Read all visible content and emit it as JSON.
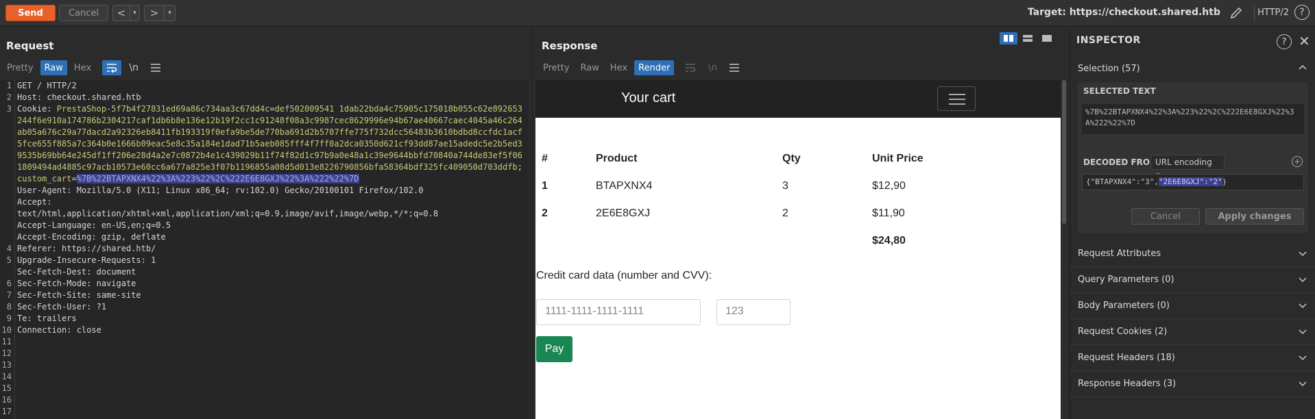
{
  "toolbar": {
    "send_label": "Send",
    "cancel_label": "Cancel",
    "target_label": "Target: https://checkout.shared.htb",
    "protocol": "HTTP/2"
  },
  "request": {
    "title": "Request",
    "tabs": [
      "Pretty",
      "Raw",
      "Hex"
    ],
    "active_tab": "Raw",
    "newline_toggle": "\\n",
    "line_numbers": [
      "1",
      "2",
      "3",
      "",
      "",
      "",
      "",
      "",
      "",
      "",
      "",
      "",
      "4",
      "5",
      "",
      "6",
      "7",
      "8",
      "9",
      "10",
      "11",
      "12",
      "13",
      "14",
      "15",
      "16",
      "17"
    ],
    "lines": {
      "l1": "GET / HTTP/2",
      "l2": "Host: checkout.shared.htb",
      "l3_key": "Cookie: ",
      "l3_ps_name": "PrestaShop-5f7b4f27831ed69a86c734aa3c67dd4c",
      "l3_ps_value": "def502009541 1dab22bda4c75905c175018b055c62e892653244f6e910a174786b2304217caf1db6b8e136e12b19f2cc1c91248f08a3c9987cec8629996e94b67ae40667caec4045a46c264ab05a676c29a77dacd2a92326eb8411fb193319f0efa9be5de770ba691d2b5707ffe775f732dcc56483b3610bdbd8ccfdc1acf5fce655f885a7c364b0e1666b09eac5e8c35a184e1dad71b5aeb085fff4f7ff0a2dca0350d621cf93dd87ae15adedc5e2b5ed39535b69bb64e245df1ff206e28d4a2e7c0872b4e1c439029b11f74f82d1c97b9a0e48a1c39e9644bbfd70840a744de83ef5f061809494ad4885c97acb10573e60cc6a677a825e3f07b1196855a08d5d013e8226790856bfa58364bdf325fc409050d703ddfb",
      "l3_sep": "; ",
      "l3_cart_name": "custom_cart",
      "l3_cart_value": "%7B%22BTAPXNX4%22%3A%223%22%2C%222E6E8GXJ%22%3A%222%22%7D",
      "l4": "User-Agent: Mozilla/5.0 (X11; Linux x86_64; rv:102.0) Gecko/20100101 Firefox/102.0",
      "l5": "Accept:",
      "l5b": "text/html,application/xhtml+xml,application/xml;q=0.9,image/avif,image/webp,*/*;q=0.8",
      "l6": "Accept-Language: en-US,en;q=0.5",
      "l7": "Accept-Encoding: gzip, deflate",
      "l8": "Referer: https://shared.htb/",
      "l9": "Upgrade-Insecure-Requests: 1",
      "l10": "Sec-Fetch-Dest: document",
      "l11": "Sec-Fetch-Mode: navigate",
      "l12": "Sec-Fetch-Site: same-site",
      "l13": "Sec-Fetch-User: ?1",
      "l14": "Te: trailers",
      "l15": "Connection: close"
    }
  },
  "response": {
    "title": "Response",
    "tabs": [
      "Pretty",
      "Raw",
      "Hex",
      "Render"
    ],
    "active_tab": "Render",
    "page": {
      "brand": "Your cart",
      "columns": [
        "#",
        "Product",
        "Qty",
        "Unit Price"
      ],
      "rows": [
        {
          "n": "1",
          "product": "BTAPXNX4",
          "qty": "3",
          "price": "$12,90"
        },
        {
          "n": "2",
          "product": "2E6E8GXJ",
          "qty": "2",
          "price": "$11,90"
        }
      ],
      "total": "$24,80",
      "cc_label": "Credit card data (number and CVV):",
      "cc_placeholder": "1111-1111-1111-1111",
      "cvv_placeholder": "123",
      "pay_label": "Pay"
    }
  },
  "inspector": {
    "title": "INSPECTOR",
    "selection_label": "Selection (57)",
    "selected_text_label": "SELECTED TEXT",
    "selected_text": "%7B%22BTAPXNX4%22%3A%223%22%2C%222E6E8GXJ%22%3A%222%22%7D",
    "decoded_from_label": "DECODED FROM:",
    "decoded_from_value": "URL encoding",
    "decoded_prefix": "{\"BTAPXNX4\":\"3\",",
    "decoded_selected": "\"2E6E8GXJ\":\"2\"",
    "decoded_suffix": "}",
    "cancel_label": "Cancel",
    "apply_label": "Apply changes",
    "sections": [
      "Request Attributes",
      "Query Parameters (0)",
      "Body Parameters (0)",
      "Request Cookies (2)",
      "Request Headers (18)",
      "Response Headers (3)"
    ]
  }
}
